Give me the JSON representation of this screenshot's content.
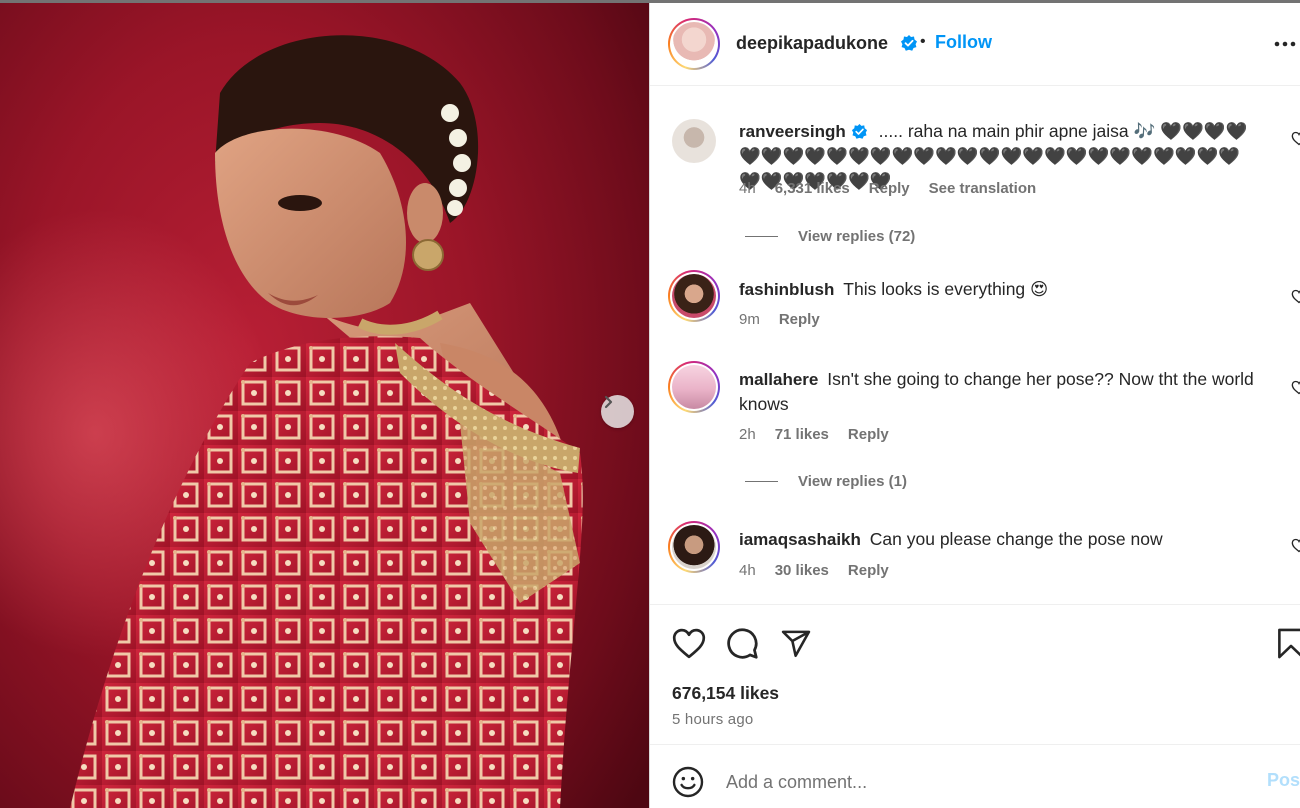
{
  "post": {
    "author": "deepikapadukone",
    "follow_label": "Follow",
    "separator": "•",
    "likes": "676,154 likes",
    "time_ago": "5 hours ago",
    "comment_placeholder": "Add a comment...",
    "post_label": "Post"
  },
  "comments": [
    {
      "username": "ranveersingh",
      "verified": true,
      "text": "..... raha na main phir apne jaisa 🎶 🖤🖤🖤🖤🖤🖤🖤🖤🖤🖤🖤🖤🖤🖤🖤🖤🖤🖤🖤🖤🖤🖤🖤🖤🖤🖤🖤🖤🖤🖤🖤🖤🖤🖤",
      "time": "4h",
      "likes": "6,331 likes",
      "reply": "Reply",
      "translation": "See translation",
      "view_replies": "View replies (72)"
    },
    {
      "username": "fashinblush",
      "verified": false,
      "text": "This looks is everything 😍",
      "time": "9m",
      "reply": "Reply"
    },
    {
      "username": "mallahere",
      "verified": false,
      "text": "Isn't she going to change her pose?? Now tht the world knows",
      "time": "2h",
      "likes": "71 likes",
      "reply": "Reply",
      "view_replies": "View replies (1)"
    },
    {
      "username": "iamaqsashaikh",
      "verified": false,
      "text": "Can you please change the pose now",
      "time": "4h",
      "likes": "30 likes",
      "reply": "Reply"
    }
  ],
  "icons": {
    "verified": "verified-badge-icon",
    "more": "more-options-icon",
    "next": "chevron-right-icon",
    "like": "heart-icon",
    "comment": "comment-bubble-icon",
    "share": "paper-plane-icon",
    "save": "bookmark-icon",
    "emoji": "smiley-icon"
  },
  "colors": {
    "accent": "#0095f6",
    "post_disabled": "#b2dffc",
    "muted": "#737373",
    "text": "#262626",
    "photo_red": "#9a1528"
  }
}
